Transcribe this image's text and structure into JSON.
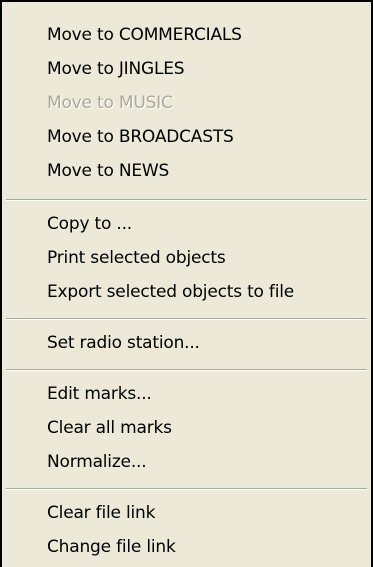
{
  "menu": {
    "items": [
      {
        "label": "Move to COMMERCIALS",
        "enabled": true
      },
      {
        "label": "Move to JINGLES",
        "enabled": true
      },
      {
        "label": "Move to MUSIC",
        "enabled": false
      },
      {
        "label": "Move to BROADCASTS",
        "enabled": true
      },
      {
        "label": "Move to NEWS",
        "enabled": true
      },
      {
        "label": "Copy to ...",
        "enabled": true
      },
      {
        "label": "Print selected objects",
        "enabled": true
      },
      {
        "label": "Export selected objects to file",
        "enabled": true
      },
      {
        "label": "Set radio station...",
        "enabled": true
      },
      {
        "label": "Edit marks...",
        "enabled": true
      },
      {
        "label": "Clear all marks",
        "enabled": true
      },
      {
        "label": "Normalize...",
        "enabled": true
      },
      {
        "label": "Clear file link",
        "enabled": true
      },
      {
        "label": "Change file link",
        "enabled": true
      }
    ]
  },
  "colors": {
    "menu_background": "#ECE9D8",
    "text": "#000000",
    "disabled_text": "#ACA899",
    "separator_dark": "#ACA899",
    "separator_light": "#FFFFFF",
    "border": "#000000"
  }
}
